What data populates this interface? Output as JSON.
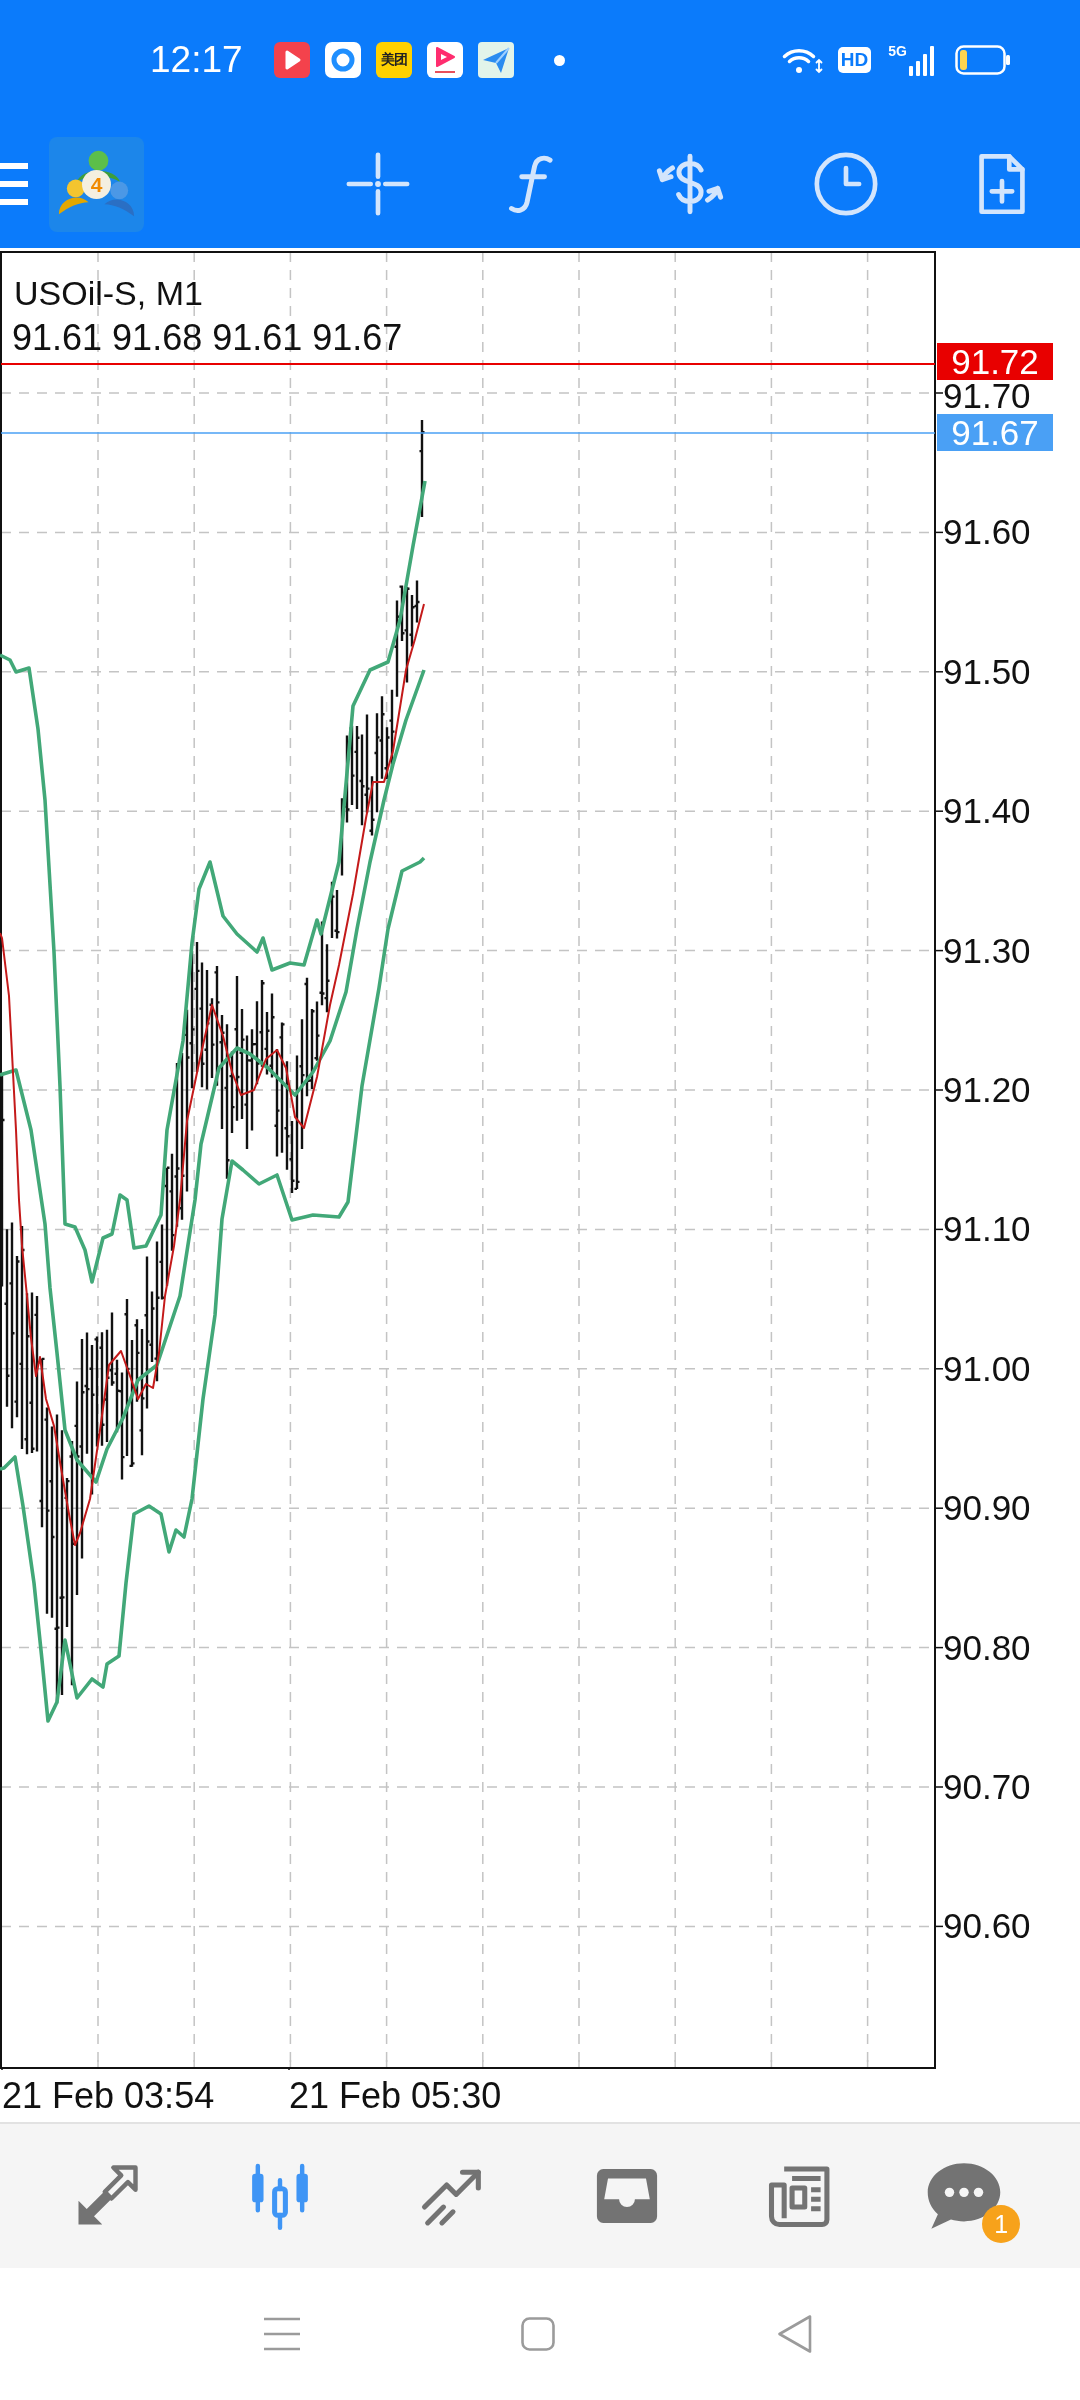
{
  "status_bar": {
    "time": "12:17",
    "app_label": "美团",
    "network_badge": "HD",
    "network_type": "5G"
  },
  "toolbar": {
    "logo_badge": "4"
  },
  "chart": {
    "symbol": "USOil-S, M1",
    "ohlc": "91.61 91.68 91.61 91.67",
    "price_labels": [
      "91.70",
      "91.60",
      "91.50",
      "91.40",
      "91.30",
      "91.20",
      "91.10",
      "91.00",
      "90.90",
      "90.80",
      "90.70",
      "90.60"
    ],
    "price_lines": [
      {
        "label": "91.72",
        "color": "#e80000"
      },
      {
        "label": "91.67",
        "color": "#4aa0f5"
      }
    ],
    "time_labels": [
      "21 Feb 03:54",
      "21 Feb 05:30"
    ]
  },
  "bottom_nav": {
    "items": [
      {
        "kind": "trade",
        "selected": false
      },
      {
        "kind": "chart",
        "selected": true
      },
      {
        "kind": "trend",
        "selected": false
      },
      {
        "kind": "inbox",
        "selected": false
      },
      {
        "kind": "news",
        "selected": false
      },
      {
        "kind": "chat",
        "selected": false,
        "badge": "1"
      }
    ]
  }
}
